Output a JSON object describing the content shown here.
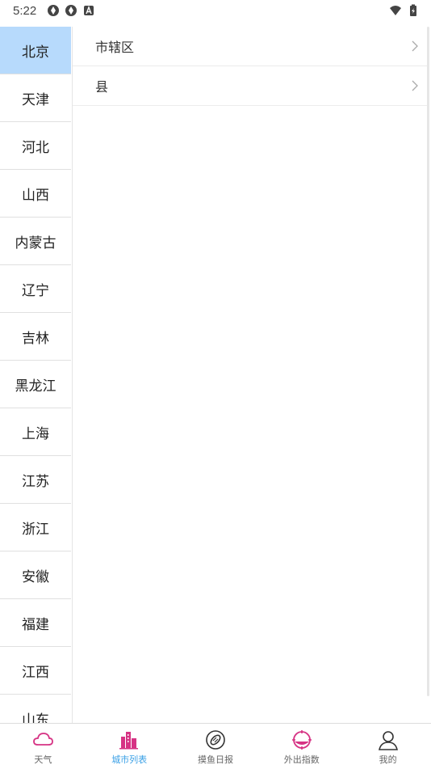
{
  "status_bar": {
    "time": "5:22"
  },
  "provinces": [
    {
      "label": "北京",
      "active": true
    },
    {
      "label": "天津"
    },
    {
      "label": "河北"
    },
    {
      "label": "山西"
    },
    {
      "label": "内蒙古"
    },
    {
      "label": "辽宁"
    },
    {
      "label": "吉林"
    },
    {
      "label": "黑龙江"
    },
    {
      "label": "上海"
    },
    {
      "label": "江苏"
    },
    {
      "label": "浙江"
    },
    {
      "label": "安徽"
    },
    {
      "label": "福建"
    },
    {
      "label": "江西"
    },
    {
      "label": "山东"
    }
  ],
  "cities": [
    {
      "label": "市辖区"
    },
    {
      "label": "县"
    }
  ],
  "tabs": [
    {
      "label": "天气",
      "icon": "cloud-icon"
    },
    {
      "label": "城市列表",
      "icon": "city-icon",
      "active": true
    },
    {
      "label": "摸鱼日报",
      "icon": "fish-icon"
    },
    {
      "label": "外出指数",
      "icon": "sunset-icon"
    },
    {
      "label": "我的",
      "icon": "person-icon"
    }
  ],
  "colors": {
    "accent": "#3aa0e6",
    "active_province_bg": "#b7dafc",
    "icon_pink": "#d63384"
  }
}
